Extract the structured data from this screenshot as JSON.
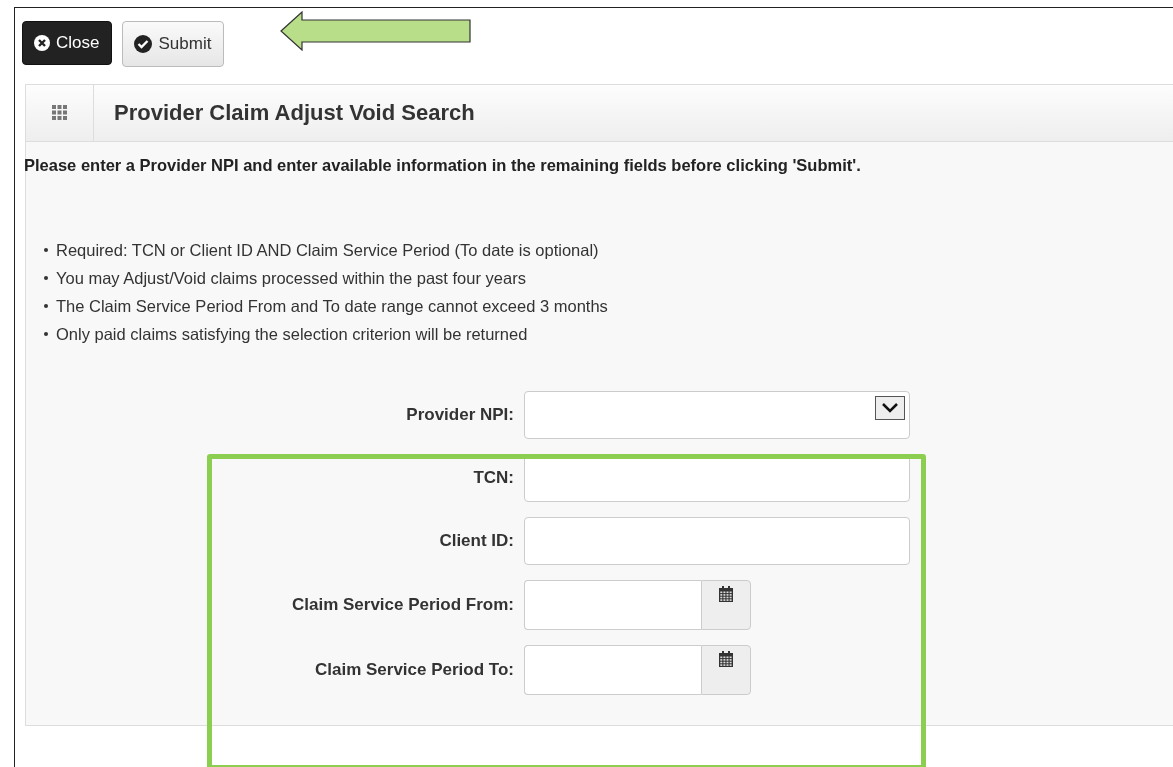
{
  "toolbar": {
    "buttons": [
      {
        "label": "Close",
        "kind": "close"
      },
      {
        "label": "Submit",
        "kind": "submit"
      }
    ]
  },
  "panel": {
    "title": "Provider Claim Adjust Void Search",
    "instruction": "Please enter a Provider NPI and enter available information in the remaining fields before clicking 'Submit'.",
    "notes": [
      "Required: TCN or Client ID AND Claim Service Period (To date is optional)",
      "You may Adjust/Void claims processed within the past four years",
      "The Claim Service Period From and To date range cannot exceed 3 months",
      "Only paid claims satisfying the selection criterion will be returned"
    ],
    "fields": [
      {
        "label": "Provider NPI:",
        "kind": "select"
      },
      {
        "label": "TCN:",
        "kind": "text"
      },
      {
        "label": "Client ID:",
        "kind": "text"
      },
      {
        "label": "Claim Service Period From:",
        "kind": "date"
      },
      {
        "label": "Claim Service Period To:",
        "kind": "date"
      }
    ]
  }
}
